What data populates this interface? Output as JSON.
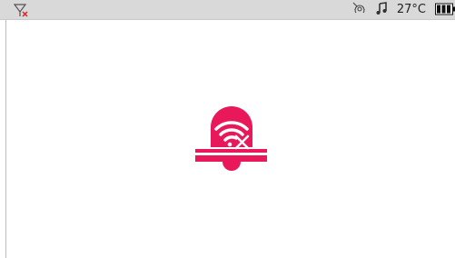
{
  "status_bar": {
    "left_icon": "no-signal-icon",
    "right_icons": [
      "hotspot-icon",
      "music-note-icon"
    ],
    "temperature": "27°C",
    "battery_icon": "battery-icon",
    "background_color": "#d9d9d9"
  },
  "main": {
    "center_icon": "bell-wifi-off-icon",
    "accent_color": "#e8185a"
  }
}
